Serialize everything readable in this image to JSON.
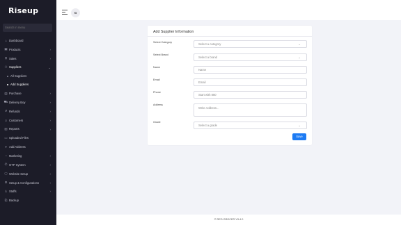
{
  "sidebar": {
    "brand": "Riseup",
    "search_placeholder": "Search in menu",
    "items": [
      {
        "label": "Dashboard",
        "icon": "home-icon",
        "glyph": "⌂",
        "chevron": false
      },
      {
        "label": "Products",
        "icon": "box-icon",
        "glyph": "▣",
        "chevron": true
      },
      {
        "label": "Sales",
        "icon": "cart-icon",
        "glyph": "⊡",
        "chevron": true
      },
      {
        "label": "Suppliers",
        "icon": "users-icon",
        "glyph": "⚇",
        "chevron": true,
        "expanded": true
      },
      {
        "label": "All Suppliers",
        "sub": true
      },
      {
        "label": "Add Suppliers",
        "sub": true,
        "active": true
      },
      {
        "label": "Purchase",
        "icon": "bag-icon",
        "glyph": "▤",
        "chevron": true
      },
      {
        "label": "Delivery Boy",
        "icon": "truck-icon",
        "glyph": "⛟",
        "chevron": true
      },
      {
        "label": "Refunds",
        "icon": "refund-icon",
        "glyph": "↺",
        "chevron": true
      },
      {
        "label": "Customers",
        "icon": "user-icon",
        "glyph": "☺",
        "chevron": true
      },
      {
        "label": "Reports",
        "icon": "report-icon",
        "glyph": "▥",
        "chevron": true
      },
      {
        "label": "Uploaded Files",
        "icon": "folder-icon",
        "glyph": "▭",
        "chevron": false
      },
      {
        "label": "Add Address",
        "icon": "location-icon",
        "glyph": "⌖",
        "chevron": false
      },
      {
        "label": "Marketing",
        "icon": "megaphone-icon",
        "glyph": "◔",
        "chevron": true
      },
      {
        "label": "OTP System",
        "icon": "phone-icon",
        "glyph": "✆",
        "chevron": true
      },
      {
        "label": "Website Setup",
        "icon": "desktop-icon",
        "glyph": "▢",
        "chevron": true
      },
      {
        "label": "Setup & Configurations",
        "icon": "gear-icon",
        "glyph": "⚙",
        "chevron": true
      },
      {
        "label": "Staffs",
        "icon": "staff-icon",
        "glyph": "♙",
        "chevron": true
      },
      {
        "label": "Backup",
        "icon": "backup-icon",
        "glyph": "⎘",
        "chevron": false
      }
    ]
  },
  "topbar": {
    "avatar_initials": "G"
  },
  "form": {
    "title": "Add Supplier Information",
    "fields": {
      "category": {
        "label": "Select Category",
        "placeholder": "Select a category"
      },
      "brand": {
        "label": "Select Brand",
        "placeholder": "Select a brand"
      },
      "name": {
        "label": "Name",
        "placeholder": "Name"
      },
      "email": {
        "label": "Email",
        "placeholder": "Email"
      },
      "phone": {
        "label": "Phone",
        "placeholder": "Start with 880"
      },
      "address": {
        "label": "Address",
        "placeholder": "Write Address..."
      },
      "grade": {
        "label": "Grade",
        "placeholder": "Select a grade"
      }
    },
    "save_label": "Save"
  },
  "footer": {
    "text": "© RED GROCER V3.4.0"
  },
  "colors": {
    "sidebar_bg": "#1c1c28",
    "primary": "#1d7bf3",
    "page_bg": "#f2f3f8"
  }
}
